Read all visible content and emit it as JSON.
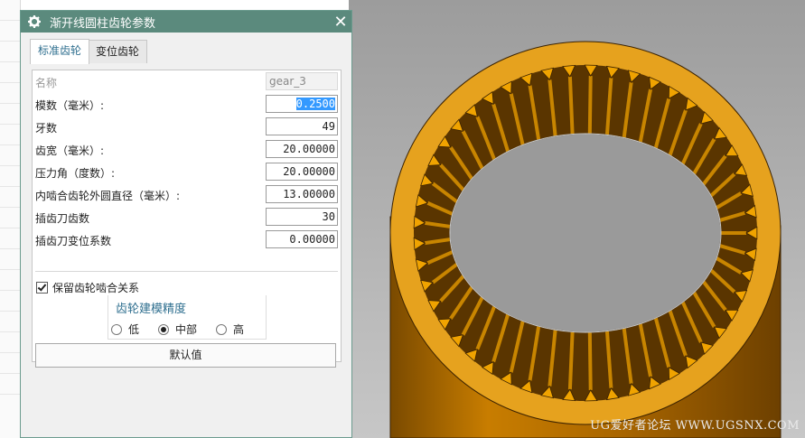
{
  "dialog": {
    "title": "渐开线圆柱齿轮参数",
    "close_label": "✕",
    "tabs": [
      {
        "label": "标准齿轮",
        "active": true
      },
      {
        "label": "变位齿轮",
        "active": false
      }
    ],
    "fields": {
      "name": {
        "label": "名称",
        "value": "gear_3"
      },
      "module": {
        "label": "模数（毫米）:",
        "value": "0.2500"
      },
      "teeth": {
        "label": "牙数",
        "value": "49"
      },
      "face_width": {
        "label": "齿宽（毫米）:",
        "value": "20.00000"
      },
      "pressure_angle": {
        "label": "压力角（度数）:",
        "value": "20.00000"
      },
      "outer_diameter": {
        "label": "内啮合齿轮外圆直径（毫米）:",
        "value": "13.00000"
      },
      "cutter_teeth": {
        "label": "插齿刀齿数",
        "value": "30"
      },
      "cutter_shift": {
        "label": "插齿刀变位系数",
        "value": "0.00000"
      }
    },
    "keep_mesh": {
      "label": "保留齿轮啮合关系",
      "checked": true
    },
    "precision": {
      "title": "齿轮建模精度",
      "options": [
        {
          "label": "低",
          "selected": false
        },
        {
          "label": "中部",
          "selected": true
        },
        {
          "label": "高",
          "selected": false
        }
      ]
    },
    "default_button": "默认值"
  },
  "viewport": {
    "watermark": "UG爱好者论坛 WWW.UGSNX.COM",
    "colors": {
      "gear": "#d98c00",
      "tooth": "#f0a300",
      "background": "#b5b5b5"
    }
  }
}
